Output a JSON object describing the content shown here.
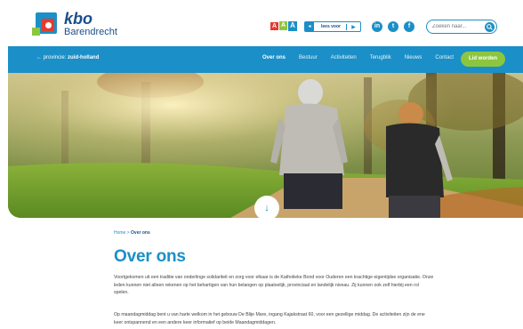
{
  "header": {
    "brand_name": "kbo",
    "brand_city": "Barendrecht",
    "font_sizes": [
      "A",
      "A",
      "A"
    ],
    "readspeaker_label": "lees voor",
    "readspeaker_play": "▶",
    "social": [
      "in",
      "t",
      "f"
    ],
    "search_placeholder": "Zoeken naar...",
    "search_icon": "search-icon"
  },
  "nav": {
    "province_prefix": "← provincie:",
    "province_value": "zuid-holland",
    "items": [
      "Over ons",
      "Bestuur",
      "Activiteiten",
      "Terugblik",
      "Nieuws",
      "Contact"
    ],
    "active_index": 0,
    "join_label": "Lid worden"
  },
  "hero": {
    "scroll_icon": "↓"
  },
  "breadcrumb": {
    "home": "Home",
    "separator": ">",
    "current": "Over ons"
  },
  "main": {
    "title": "Over ons",
    "paragraph1": "Voortgekomen uit een traditie van onderlinge solidariteit en zorg voor elkaar is de Katholieke Bond voor Ouderen een krachtige eigentijdse organisatie. Onze leden kunnen niet alleen rekenen op het behartigen van hun belangen op plaatselijk, provinciaal en landelijk niveau. Zij kunnen ook zelf hierbij een rol spelen.",
    "paragraph2": "Op maandagmiddag bent u van harte welkom in het gebouw De Blije Mare, ingang Kajakstraat 60, voor een gezellige middag. De activiteiten zijn de ene keer ontspannend en een andere keer informatief op beide Maandagmiddagen."
  },
  "colors": {
    "primary": "#1b8fc7",
    "navy": "#1a4f8b",
    "green": "#8cc63f",
    "red": "#e53a2f"
  }
}
